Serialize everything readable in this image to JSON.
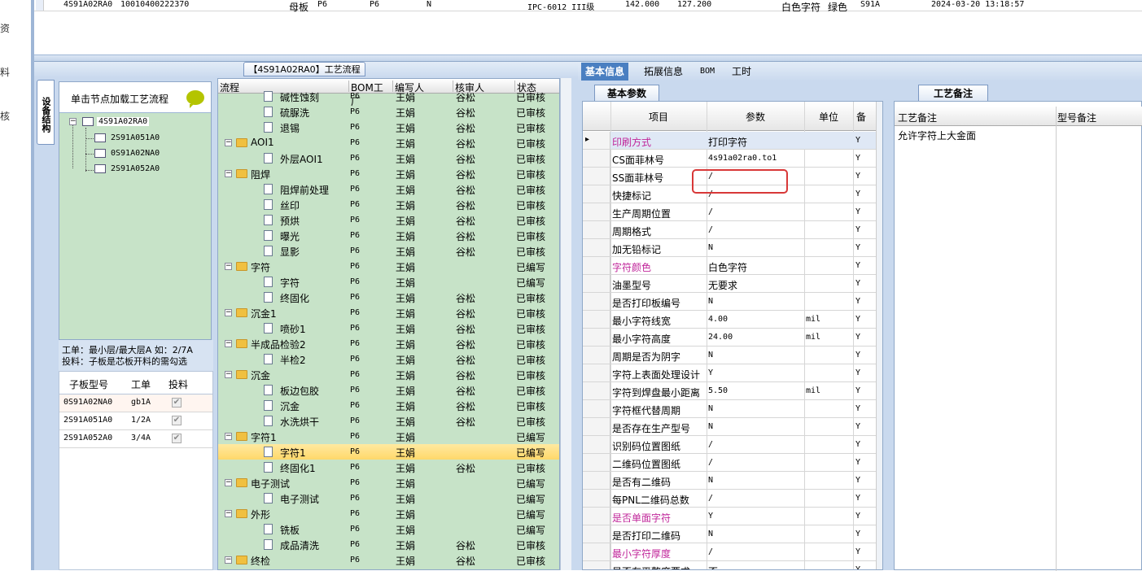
{
  "left_nav": {
    "items": [
      "资",
      "料",
      "核"
    ]
  },
  "top_row": {
    "id": "4S91A02RA0",
    "code": "10010400222370",
    "type": "母板",
    "p1": "P6",
    "p2": "P6",
    "flag": "N",
    "grade": "IPC-6012 III级",
    "a": "142.000",
    "b": "127.200",
    "char": "白色字符",
    "color": "绿色",
    "model": "S91A",
    "time": "2024-03-20 13:18:57"
  },
  "flow_title": "【4S91A02RA0】工艺流程",
  "device_tab": "设备结构",
  "device_panel": {
    "hint": "单击节点加载工艺流程",
    "root": "4S91A02RA0",
    "children": [
      "2S91A051A0",
      "0S91A02NA0",
      "2S91A052A0"
    ]
  },
  "info": {
    "line1": "工单：最小层/最大层A 如：2/7A",
    "line2": "投料：子板是芯板开料的需勾选"
  },
  "sub_table": {
    "headers": [
      "子板型号",
      "工单",
      "投料"
    ],
    "rows": [
      [
        "0S91A02NA0",
        "gb1A",
        "✔"
      ],
      [
        "2S91A051A0",
        "1/2A",
        "✔"
      ],
      [
        "2S91A052A0",
        "3/4A",
        "✔"
      ]
    ]
  },
  "flow": {
    "headers": [
      "流程",
      "BOM工厂",
      "编写人",
      "核审人",
      "状态"
    ],
    "rows": [
      {
        "n": "碱性蚀刻",
        "lvl": 2,
        "f": "P6",
        "w": "王娟",
        "r": "谷松",
        "s": "已审核"
      },
      {
        "n": "硫脲洗",
        "lvl": 2,
        "f": "P6",
        "w": "王娟",
        "r": "谷松",
        "s": "已审核"
      },
      {
        "n": "退锡",
        "lvl": 2,
        "f": "P6",
        "w": "王娟",
        "r": "谷松",
        "s": "已审核"
      },
      {
        "n": "AOI1",
        "lvl": 1,
        "f": "P6",
        "w": "王娟",
        "r": "谷松",
        "s": "已审核"
      },
      {
        "n": "外层AOI1",
        "lvl": 2,
        "f": "P6",
        "w": "王娟",
        "r": "谷松",
        "s": "已审核"
      },
      {
        "n": "阻焊",
        "lvl": 1,
        "f": "P6",
        "w": "王娟",
        "r": "谷松",
        "s": "已审核"
      },
      {
        "n": "阻焊前处理",
        "lvl": 2,
        "f": "P6",
        "w": "王娟",
        "r": "谷松",
        "s": "已审核"
      },
      {
        "n": "丝印",
        "lvl": 2,
        "f": "P6",
        "w": "王娟",
        "r": "谷松",
        "s": "已审核"
      },
      {
        "n": "预烘",
        "lvl": 2,
        "f": "P6",
        "w": "王娟",
        "r": "谷松",
        "s": "已审核"
      },
      {
        "n": "曝光",
        "lvl": 2,
        "f": "P6",
        "w": "王娟",
        "r": "谷松",
        "s": "已审核"
      },
      {
        "n": "显影",
        "lvl": 2,
        "f": "P6",
        "w": "王娟",
        "r": "谷松",
        "s": "已审核"
      },
      {
        "n": "字符",
        "lvl": 1,
        "f": "P6",
        "w": "王娟",
        "r": "",
        "s": "已编写"
      },
      {
        "n": "字符",
        "lvl": 2,
        "f": "P6",
        "w": "王娟",
        "r": "",
        "s": "已编写"
      },
      {
        "n": "终固化",
        "lvl": 2,
        "f": "P6",
        "w": "王娟",
        "r": "谷松",
        "s": "已审核"
      },
      {
        "n": "沉金1",
        "lvl": 1,
        "f": "P6",
        "w": "王娟",
        "r": "谷松",
        "s": "已审核"
      },
      {
        "n": "喷砂1",
        "lvl": 2,
        "f": "P6",
        "w": "王娟",
        "r": "谷松",
        "s": "已审核"
      },
      {
        "n": "半成品检验2",
        "lvl": 1,
        "f": "P6",
        "w": "王娟",
        "r": "谷松",
        "s": "已审核"
      },
      {
        "n": "半检2",
        "lvl": 2,
        "f": "P6",
        "w": "王娟",
        "r": "谷松",
        "s": "已审核"
      },
      {
        "n": "沉金",
        "lvl": 1,
        "f": "P6",
        "w": "王娟",
        "r": "谷松",
        "s": "已审核"
      },
      {
        "n": "板边包胶",
        "lvl": 2,
        "f": "P6",
        "w": "王娟",
        "r": "谷松",
        "s": "已审核"
      },
      {
        "n": "沉金",
        "lvl": 2,
        "f": "P6",
        "w": "王娟",
        "r": "谷松",
        "s": "已审核"
      },
      {
        "n": "水洗烘干",
        "lvl": 2,
        "f": "P6",
        "w": "王娟",
        "r": "谷松",
        "s": "已审核"
      },
      {
        "n": "字符1",
        "lvl": 1,
        "f": "P6",
        "w": "王娟",
        "r": "",
        "s": "已编写"
      },
      {
        "n": "字符1",
        "lvl": 2,
        "f": "P6",
        "w": "王娟",
        "r": "",
        "s": "已编写",
        "sel": true
      },
      {
        "n": "终固化1",
        "lvl": 2,
        "f": "P6",
        "w": "王娟",
        "r": "谷松",
        "s": "已审核"
      },
      {
        "n": "电子测试",
        "lvl": 1,
        "f": "P6",
        "w": "王娟",
        "r": "",
        "s": "已编写"
      },
      {
        "n": "电子测试",
        "lvl": 2,
        "f": "P6",
        "w": "王娟",
        "r": "",
        "s": "已编写"
      },
      {
        "n": "外形",
        "lvl": 1,
        "f": "P6",
        "w": "王娟",
        "r": "",
        "s": "已编写"
      },
      {
        "n": "铣板",
        "lvl": 2,
        "f": "P6",
        "w": "王娟",
        "r": "",
        "s": "已编写"
      },
      {
        "n": "成品清洗",
        "lvl": 2,
        "f": "P6",
        "w": "王娟",
        "r": "谷松",
        "s": "已审核"
      },
      {
        "n": "终检",
        "lvl": 1,
        "f": "P6",
        "w": "王娟",
        "r": "谷松",
        "s": "已审核"
      }
    ]
  },
  "tabs": [
    "基本信息",
    "拓展信息",
    "BOM",
    "工时"
  ],
  "basic_tab": "基本参数",
  "basic": {
    "headers": [
      "项目",
      "参数",
      "单位",
      "备"
    ],
    "rows": [
      {
        "k": "印刷方式",
        "v": "打印字符",
        "u": "",
        "y": "Y",
        "pink": true,
        "cur": true
      },
      {
        "k": "CS面菲林号",
        "v": "4s91a02ra0.to1",
        "u": "",
        "y": "Y"
      },
      {
        "k": "SS面菲林号",
        "v": "/",
        "u": "",
        "y": "Y"
      },
      {
        "k": "快捷标记",
        "v": "/",
        "u": "",
        "y": "Y"
      },
      {
        "k": "生产周期位置",
        "v": "/",
        "u": "",
        "y": "Y"
      },
      {
        "k": "周期格式",
        "v": "/",
        "u": "",
        "y": "Y"
      },
      {
        "k": "加无铅标记",
        "v": "N",
        "u": "",
        "y": "Y"
      },
      {
        "k": "字符颜色",
        "v": "白色字符",
        "u": "",
        "y": "Y",
        "pink": true
      },
      {
        "k": "油墨型号",
        "v": "无要求",
        "u": "",
        "y": "Y"
      },
      {
        "k": "是否打印板编号",
        "v": "N",
        "u": "",
        "y": "Y"
      },
      {
        "k": "最小字符线宽",
        "v": "4.00",
        "u": "mil",
        "y": "Y"
      },
      {
        "k": "最小字符高度",
        "v": "24.00",
        "u": "mil",
        "y": "Y"
      },
      {
        "k": "周期是否为阴字",
        "v": "N",
        "u": "",
        "y": "Y"
      },
      {
        "k": "字符上表面处理设计",
        "v": "Y",
        "u": "",
        "y": "Y"
      },
      {
        "k": "字符到焊盘最小距离",
        "v": "5.50",
        "u": "mil",
        "y": "Y"
      },
      {
        "k": "字符框代替周期",
        "v": "N",
        "u": "",
        "y": "Y"
      },
      {
        "k": "是否存在生产型号",
        "v": "N",
        "u": "",
        "y": "Y"
      },
      {
        "k": "识别码位置图纸",
        "v": "/",
        "u": "",
        "y": "Y"
      },
      {
        "k": "二维码位置图纸",
        "v": "/",
        "u": "",
        "y": "Y"
      },
      {
        "k": "是否有二维码",
        "v": "N",
        "u": "",
        "y": "Y"
      },
      {
        "k": "每PNL二维码总数",
        "v": "/",
        "u": "",
        "y": "Y"
      },
      {
        "k": "是否单面字符",
        "v": "Y",
        "u": "",
        "y": "Y",
        "pink": true
      },
      {
        "k": "是否打印二维码",
        "v": "N",
        "u": "",
        "y": "Y"
      },
      {
        "k": "最小字符厚度",
        "v": "/",
        "u": "",
        "y": "Y",
        "pink": true
      },
      {
        "k": "是否有平整度要求",
        "v": "否",
        "u": "",
        "y": "Y"
      }
    ]
  },
  "craft_tab": "工艺备注",
  "craft": {
    "h1": "工艺备注",
    "h2": "型号备注",
    "note": "允许字符上大金面"
  },
  "colors": {
    "accent": "#4a7fc1",
    "pink": "#c0269a",
    "green": "#c7e3c8",
    "selected": "#ffd86a",
    "red_box": "#d83838"
  }
}
